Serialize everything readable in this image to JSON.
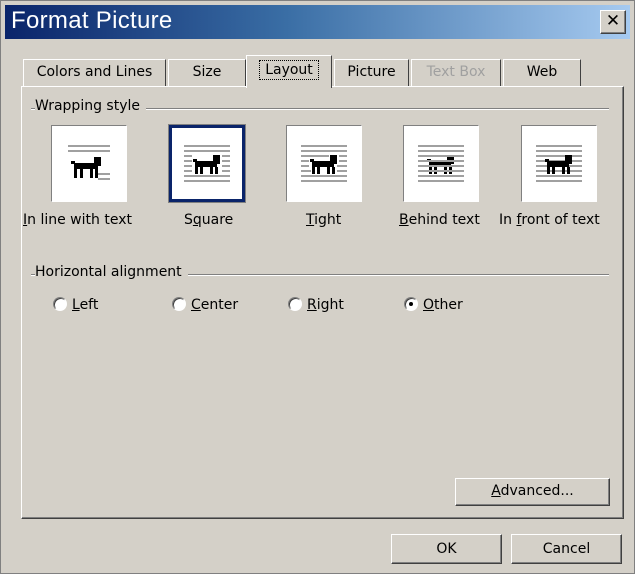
{
  "window": {
    "title": "Format Picture",
    "close_label": "✕"
  },
  "tabs": [
    {
      "label": "Colors and Lines",
      "state": "normal"
    },
    {
      "label": "Size",
      "state": "normal"
    },
    {
      "label": "Layout",
      "state": "active"
    },
    {
      "label": "Picture",
      "state": "normal"
    },
    {
      "label": "Text Box",
      "state": "disabled"
    },
    {
      "label": "Web",
      "state": "normal"
    }
  ],
  "wrapping": {
    "group_label": "Wrapping style",
    "selected": "Square",
    "options": [
      {
        "mnemonic": "I",
        "rest": "n line with text",
        "icon": "inline-dog-icon"
      },
      {
        "prefix": "S",
        "mnemonic": "q",
        "rest": "uare",
        "icon": "square-dog-icon"
      },
      {
        "mnemonic": "T",
        "rest": "ight",
        "icon": "tight-dog-icon"
      },
      {
        "mnemonic": "B",
        "rest": "ehind text",
        "icon": "behind-text-dog-icon"
      },
      {
        "prefix": "In ",
        "mnemonic": "f",
        "rest": "ront of text",
        "icon": "front-of-text-dog-icon"
      }
    ]
  },
  "alignment": {
    "group_label": "Horizontal alignment",
    "selected": "Other",
    "options": [
      {
        "mnemonic": "L",
        "rest": "eft",
        "checked": false
      },
      {
        "mnemonic": "C",
        "rest": "enter",
        "checked": false
      },
      {
        "mnemonic": "R",
        "rest": "ight",
        "checked": false
      },
      {
        "mnemonic": "O",
        "rest": "ther",
        "checked": true
      }
    ]
  },
  "buttons": {
    "advanced_mnemonic": "A",
    "advanced_rest": "dvanced...",
    "ok": "OK",
    "cancel": "Cancel"
  },
  "colors": {
    "title_start": "#0a246a",
    "title_end": "#a6caf0",
    "face": "#d4d0c8",
    "selection": "#0a246a"
  }
}
